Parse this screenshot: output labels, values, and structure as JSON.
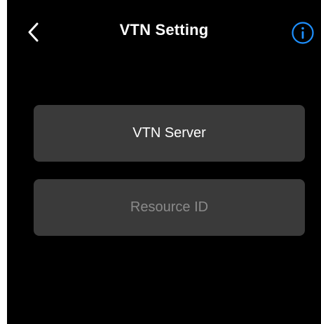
{
  "header": {
    "title": "VTN Setting",
    "back_icon": "chevron-left-icon",
    "info_icon": "info-icon",
    "accent_color": "#1e90ff"
  },
  "menu": {
    "items": [
      {
        "label": "VTN Server",
        "enabled": true
      },
      {
        "label": "Resource ID",
        "enabled": false
      }
    ]
  }
}
